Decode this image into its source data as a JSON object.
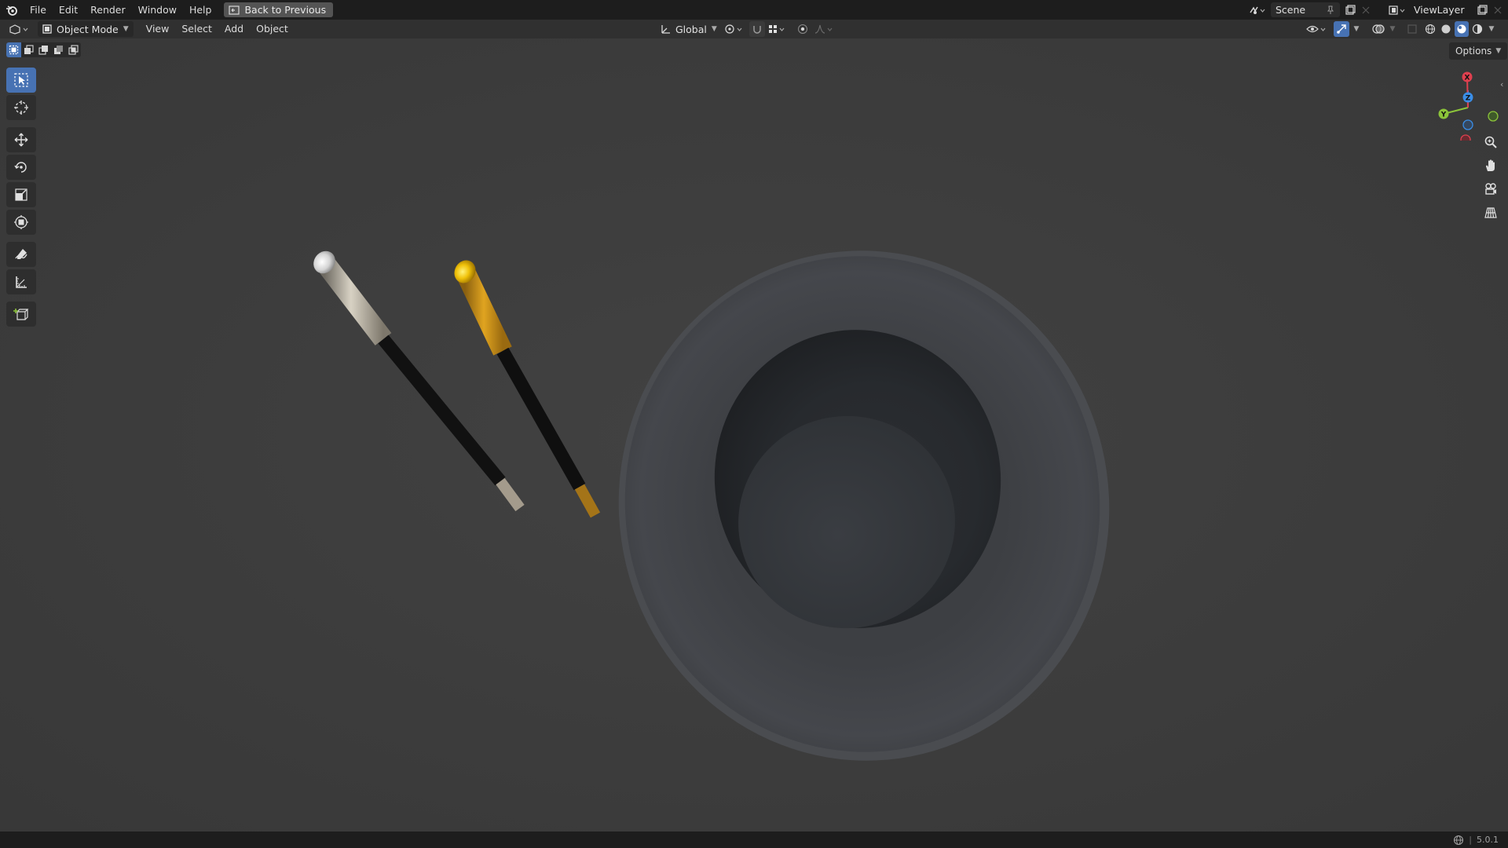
{
  "menu": {
    "file": "File",
    "edit": "Edit",
    "render": "Render",
    "window": "Window",
    "help": "Help",
    "back_to_previous": "Back to Previous"
  },
  "topbar_right": {
    "scene": "Scene",
    "view_layer": "ViewLayer"
  },
  "viewport_header": {
    "mode": "Object Mode",
    "view": "View",
    "select": "Select",
    "add": "Add",
    "object": "Object",
    "transform_orientation": "Global"
  },
  "viewport": {
    "options": "Options"
  },
  "gizmo": {
    "x": "X",
    "y": "Y",
    "z": "Z"
  },
  "status": {
    "version": "5.0.1"
  },
  "colors": {
    "accent": "#4772b3",
    "x_axis": "#e0404f",
    "y_axis": "#8cc43a",
    "z_axis": "#3a8ee8"
  }
}
